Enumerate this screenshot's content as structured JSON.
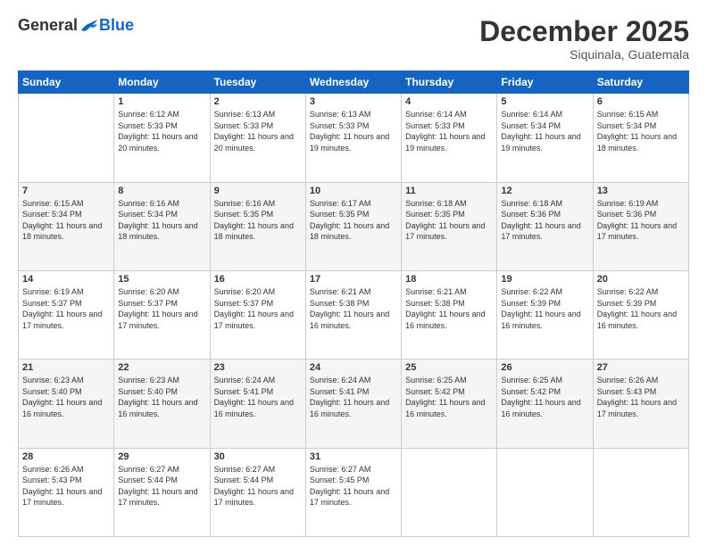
{
  "logo": {
    "general": "General",
    "blue": "Blue"
  },
  "header": {
    "month": "December 2025",
    "location": "Siquinala, Guatemala"
  },
  "weekdays": [
    "Sunday",
    "Monday",
    "Tuesday",
    "Wednesday",
    "Thursday",
    "Friday",
    "Saturday"
  ],
  "weeks": [
    [
      {
        "day": "",
        "sunrise": "",
        "sunset": "",
        "daylight": "",
        "empty": true
      },
      {
        "day": "1",
        "sunrise": "Sunrise: 6:12 AM",
        "sunset": "Sunset: 5:33 PM",
        "daylight": "Daylight: 11 hours and 20 minutes."
      },
      {
        "day": "2",
        "sunrise": "Sunrise: 6:13 AM",
        "sunset": "Sunset: 5:33 PM",
        "daylight": "Daylight: 11 hours and 20 minutes."
      },
      {
        "day": "3",
        "sunrise": "Sunrise: 6:13 AM",
        "sunset": "Sunset: 5:33 PM",
        "daylight": "Daylight: 11 hours and 19 minutes."
      },
      {
        "day": "4",
        "sunrise": "Sunrise: 6:14 AM",
        "sunset": "Sunset: 5:33 PM",
        "daylight": "Daylight: 11 hours and 19 minutes."
      },
      {
        "day": "5",
        "sunrise": "Sunrise: 6:14 AM",
        "sunset": "Sunset: 5:34 PM",
        "daylight": "Daylight: 11 hours and 19 minutes."
      },
      {
        "day": "6",
        "sunrise": "Sunrise: 6:15 AM",
        "sunset": "Sunset: 5:34 PM",
        "daylight": "Daylight: 11 hours and 18 minutes."
      }
    ],
    [
      {
        "day": "7",
        "sunrise": "Sunrise: 6:15 AM",
        "sunset": "Sunset: 5:34 PM",
        "daylight": "Daylight: 11 hours and 18 minutes."
      },
      {
        "day": "8",
        "sunrise": "Sunrise: 6:16 AM",
        "sunset": "Sunset: 5:34 PM",
        "daylight": "Daylight: 11 hours and 18 minutes."
      },
      {
        "day": "9",
        "sunrise": "Sunrise: 6:16 AM",
        "sunset": "Sunset: 5:35 PM",
        "daylight": "Daylight: 11 hours and 18 minutes."
      },
      {
        "day": "10",
        "sunrise": "Sunrise: 6:17 AM",
        "sunset": "Sunset: 5:35 PM",
        "daylight": "Daylight: 11 hours and 18 minutes."
      },
      {
        "day": "11",
        "sunrise": "Sunrise: 6:18 AM",
        "sunset": "Sunset: 5:35 PM",
        "daylight": "Daylight: 11 hours and 17 minutes."
      },
      {
        "day": "12",
        "sunrise": "Sunrise: 6:18 AM",
        "sunset": "Sunset: 5:36 PM",
        "daylight": "Daylight: 11 hours and 17 minutes."
      },
      {
        "day": "13",
        "sunrise": "Sunrise: 6:19 AM",
        "sunset": "Sunset: 5:36 PM",
        "daylight": "Daylight: 11 hours and 17 minutes."
      }
    ],
    [
      {
        "day": "14",
        "sunrise": "Sunrise: 6:19 AM",
        "sunset": "Sunset: 5:37 PM",
        "daylight": "Daylight: 11 hours and 17 minutes."
      },
      {
        "day": "15",
        "sunrise": "Sunrise: 6:20 AM",
        "sunset": "Sunset: 5:37 PM",
        "daylight": "Daylight: 11 hours and 17 minutes."
      },
      {
        "day": "16",
        "sunrise": "Sunrise: 6:20 AM",
        "sunset": "Sunset: 5:37 PM",
        "daylight": "Daylight: 11 hours and 17 minutes."
      },
      {
        "day": "17",
        "sunrise": "Sunrise: 6:21 AM",
        "sunset": "Sunset: 5:38 PM",
        "daylight": "Daylight: 11 hours and 16 minutes."
      },
      {
        "day": "18",
        "sunrise": "Sunrise: 6:21 AM",
        "sunset": "Sunset: 5:38 PM",
        "daylight": "Daylight: 11 hours and 16 minutes."
      },
      {
        "day": "19",
        "sunrise": "Sunrise: 6:22 AM",
        "sunset": "Sunset: 5:39 PM",
        "daylight": "Daylight: 11 hours and 16 minutes."
      },
      {
        "day": "20",
        "sunrise": "Sunrise: 6:22 AM",
        "sunset": "Sunset: 5:39 PM",
        "daylight": "Daylight: 11 hours and 16 minutes."
      }
    ],
    [
      {
        "day": "21",
        "sunrise": "Sunrise: 6:23 AM",
        "sunset": "Sunset: 5:40 PM",
        "daylight": "Daylight: 11 hours and 16 minutes."
      },
      {
        "day": "22",
        "sunrise": "Sunrise: 6:23 AM",
        "sunset": "Sunset: 5:40 PM",
        "daylight": "Daylight: 11 hours and 16 minutes."
      },
      {
        "day": "23",
        "sunrise": "Sunrise: 6:24 AM",
        "sunset": "Sunset: 5:41 PM",
        "daylight": "Daylight: 11 hours and 16 minutes."
      },
      {
        "day": "24",
        "sunrise": "Sunrise: 6:24 AM",
        "sunset": "Sunset: 5:41 PM",
        "daylight": "Daylight: 11 hours and 16 minutes."
      },
      {
        "day": "25",
        "sunrise": "Sunrise: 6:25 AM",
        "sunset": "Sunset: 5:42 PM",
        "daylight": "Daylight: 11 hours and 16 minutes."
      },
      {
        "day": "26",
        "sunrise": "Sunrise: 6:25 AM",
        "sunset": "Sunset: 5:42 PM",
        "daylight": "Daylight: 11 hours and 16 minutes."
      },
      {
        "day": "27",
        "sunrise": "Sunrise: 6:26 AM",
        "sunset": "Sunset: 5:43 PM",
        "daylight": "Daylight: 11 hours and 17 minutes."
      }
    ],
    [
      {
        "day": "28",
        "sunrise": "Sunrise: 6:26 AM",
        "sunset": "Sunset: 5:43 PM",
        "daylight": "Daylight: 11 hours and 17 minutes."
      },
      {
        "day": "29",
        "sunrise": "Sunrise: 6:27 AM",
        "sunset": "Sunset: 5:44 PM",
        "daylight": "Daylight: 11 hours and 17 minutes."
      },
      {
        "day": "30",
        "sunrise": "Sunrise: 6:27 AM",
        "sunset": "Sunset: 5:44 PM",
        "daylight": "Daylight: 11 hours and 17 minutes."
      },
      {
        "day": "31",
        "sunrise": "Sunrise: 6:27 AM",
        "sunset": "Sunset: 5:45 PM",
        "daylight": "Daylight: 11 hours and 17 minutes."
      },
      {
        "day": "",
        "sunrise": "",
        "sunset": "",
        "daylight": "",
        "empty": true
      },
      {
        "day": "",
        "sunrise": "",
        "sunset": "",
        "daylight": "",
        "empty": true
      },
      {
        "day": "",
        "sunrise": "",
        "sunset": "",
        "daylight": "",
        "empty": true
      }
    ]
  ]
}
